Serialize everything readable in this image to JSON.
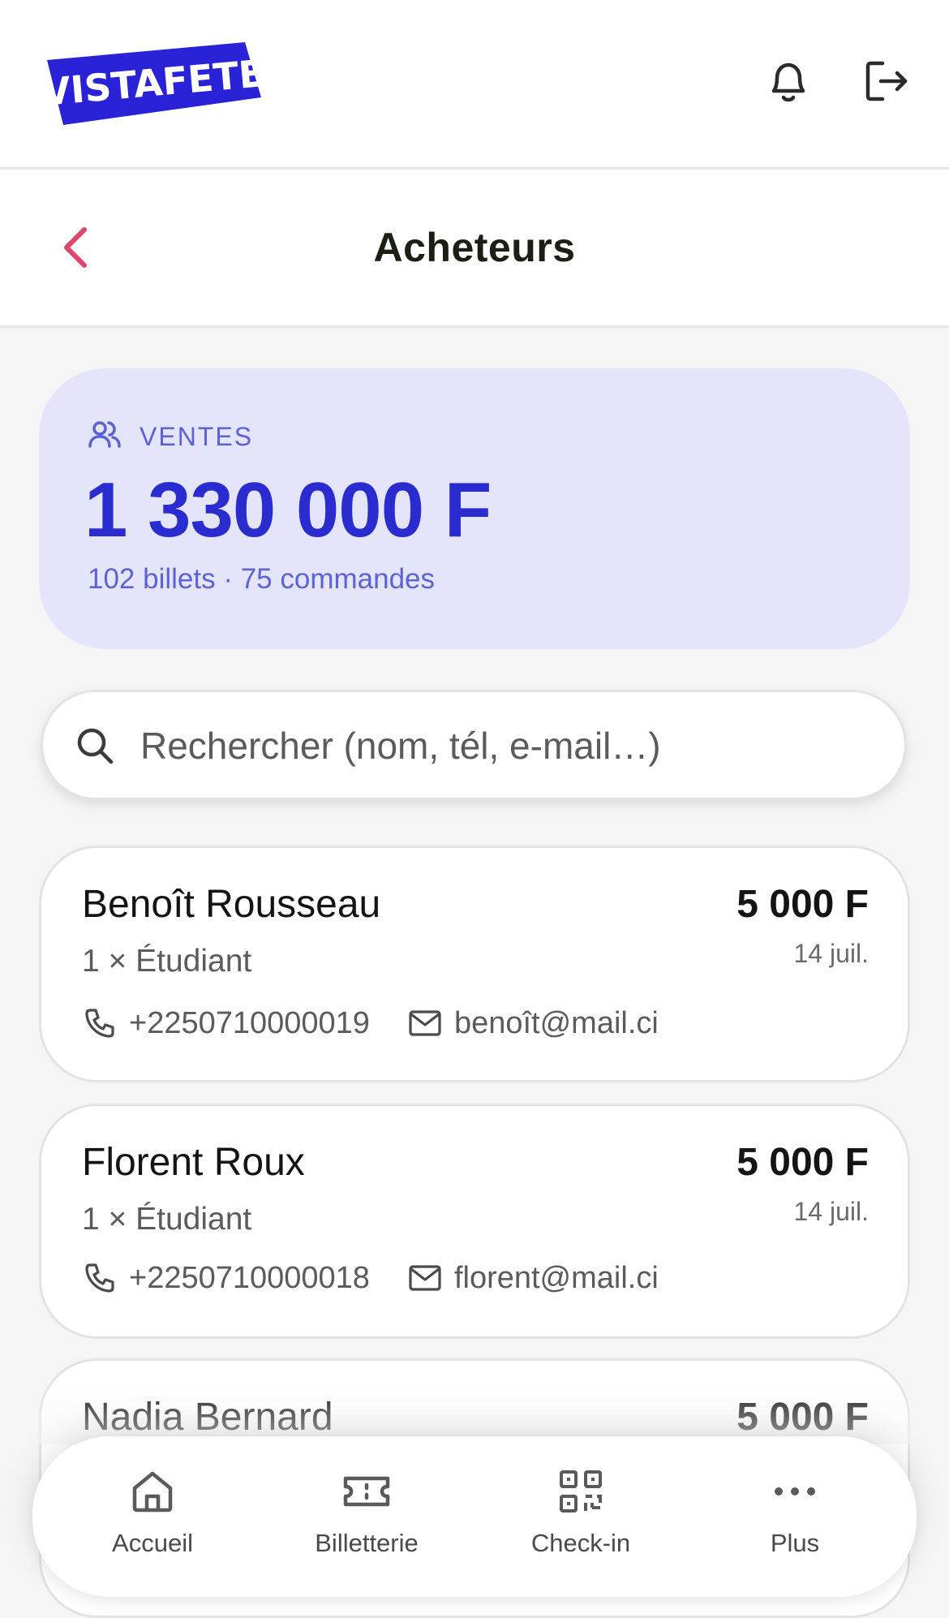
{
  "brand": {
    "logo_text": "VISTAFETE",
    "logo_color": "#2a22d6"
  },
  "header": {
    "title": "Acheteurs"
  },
  "summary": {
    "label": "VENTES",
    "amount": "1 330 000 F",
    "details": "102 billets · 75 commandes"
  },
  "search": {
    "placeholder": "Rechercher (nom, tél, e-mail…)"
  },
  "buyers": [
    {
      "name": "Benoît Rousseau",
      "price": "5 000 F",
      "ticket": "1 × Étudiant",
      "date": "14 juil.",
      "phone": "+2250710000019",
      "email": "benoît@mail.ci"
    },
    {
      "name": "Florent Roux",
      "price": "5 000 F",
      "ticket": "1 × Étudiant",
      "date": "14 juil.",
      "phone": "+2250710000018",
      "email": "florent@mail.ci"
    },
    {
      "name": "Nadia Bernard",
      "price": "5 000 F"
    }
  ],
  "nav": {
    "items": [
      {
        "label": "Accueil",
        "icon": "home-icon"
      },
      {
        "label": "Billetterie",
        "icon": "ticket-icon"
      },
      {
        "label": "Check-in",
        "icon": "qr-code-icon"
      },
      {
        "label": "Plus",
        "icon": "more-icon"
      }
    ]
  },
  "colors": {
    "accent": "#2a2ccf",
    "summary_bg": "#e4e5fa",
    "back_arrow": "#e0456b"
  }
}
